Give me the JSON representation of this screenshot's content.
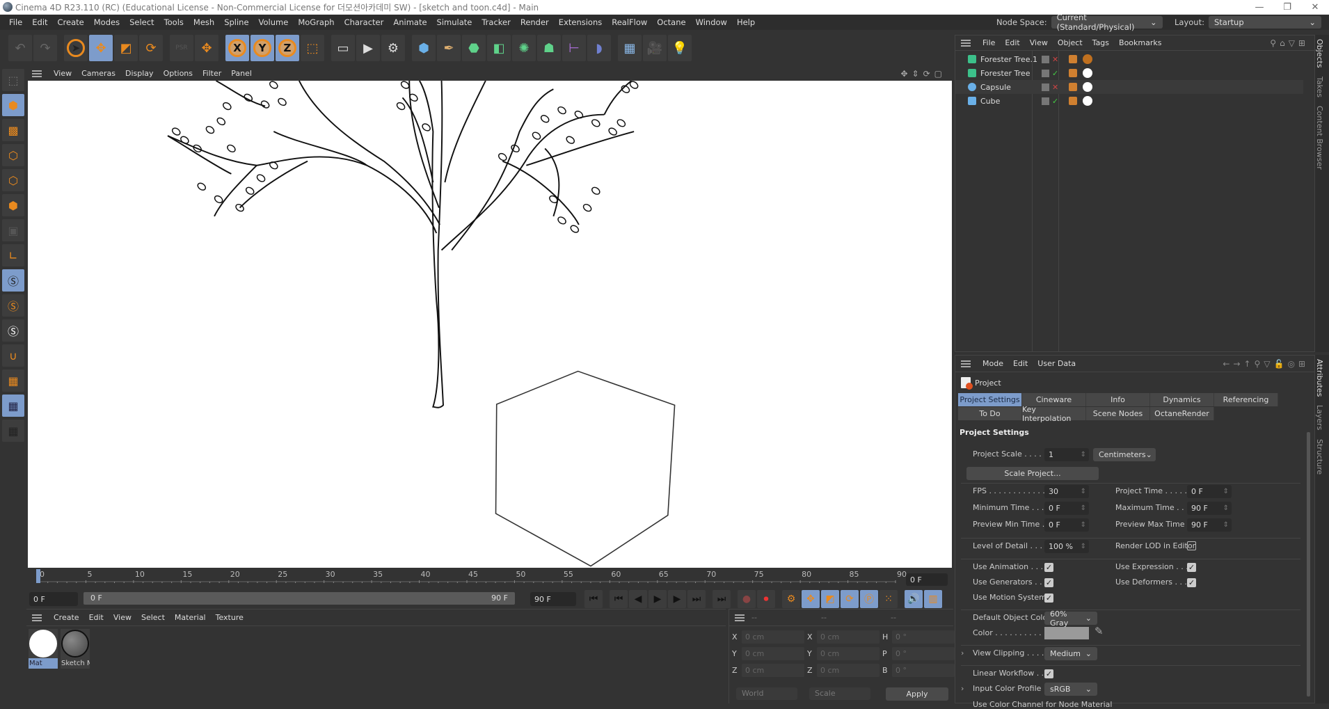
{
  "window": {
    "title": "Cinema 4D R23.110 (RC) (Educational License - Non-Commercial License for 더모션아카데미 SW) - [sketch and toon.c4d] - Main",
    "minimize": "—",
    "maximize": "❐",
    "close": "✕"
  },
  "menubar": {
    "items": [
      "File",
      "Edit",
      "Create",
      "Modes",
      "Select",
      "Tools",
      "Mesh",
      "Spline",
      "Volume",
      "MoGraph",
      "Character",
      "Animate",
      "Simulate",
      "Tracker",
      "Render",
      "Extensions",
      "RealFlow",
      "Octane",
      "Window",
      "Help"
    ],
    "node_space_label": "Node Space:",
    "node_space_value": "Current (Standard/Physical)",
    "layout_label": "Layout:",
    "layout_value": "Startup"
  },
  "toolbar": {
    "x_label": "X",
    "y_label": "Y",
    "z_label": "Z",
    "psr_label": "PSR"
  },
  "viewport": {
    "menu": [
      "View",
      "Cameras",
      "Display",
      "Options",
      "Filter",
      "Panel"
    ]
  },
  "timeline": {
    "ticks": [
      "0",
      "5",
      "10",
      "15",
      "20",
      "25",
      "30",
      "35",
      "40",
      "45",
      "50",
      "55",
      "60",
      "65",
      "70",
      "75",
      "80",
      "85",
      "90"
    ],
    "current_frame": "0 F",
    "start": "0 F",
    "range_start": "0 F",
    "range_end": "90 F",
    "end": "90 F",
    "max_frames": 90
  },
  "materials": {
    "menu": [
      "Create",
      "Edit",
      "View",
      "Select",
      "Material",
      "Texture"
    ],
    "items": [
      {
        "name": "Mat",
        "selected": true
      },
      {
        "name": "Sketch M",
        "selected": false
      }
    ]
  },
  "coords": {
    "headers": [
      "--",
      "--",
      "--"
    ],
    "rows": [
      {
        "a": "X",
        "av": "0 cm",
        "b": "X",
        "bv": "0 cm",
        "c": "H",
        "cv": "0 °"
      },
      {
        "a": "Y",
        "av": "0 cm",
        "b": "Y",
        "bv": "0 cm",
        "c": "P",
        "cv": "0 °"
      },
      {
        "a": "Z",
        "av": "0 cm",
        "b": "Z",
        "bv": "0 cm",
        "c": "B",
        "cv": "0 °"
      }
    ],
    "mode": "World",
    "scale": "Scale",
    "apply": "Apply"
  },
  "objects": {
    "menu": [
      "File",
      "Edit",
      "View",
      "Object",
      "Tags",
      "Bookmarks"
    ],
    "items": [
      {
        "name": "Forester Tree.1",
        "icon": "tree-icon",
        "enabled": false
      },
      {
        "name": "Forester Tree",
        "icon": "tree-icon",
        "enabled": true
      },
      {
        "name": "Capsule",
        "icon": "capsule-icon",
        "enabled": false
      },
      {
        "name": "Cube",
        "icon": "cube-icon",
        "enabled": true
      }
    ]
  },
  "side_tabs": {
    "top": [
      "Objects",
      "Takes",
      "Content Browser"
    ],
    "bottom": [
      "Attributes",
      "Layers",
      "Structure"
    ]
  },
  "attributes": {
    "menu": [
      "Mode",
      "Edit",
      "User Data"
    ],
    "object": "Project",
    "tabs_row1": [
      "Project Settings",
      "Cineware",
      "Info",
      "Dynamics",
      "Referencing"
    ],
    "tabs_row2": [
      "To Do",
      "Key Interpolation",
      "Scene Nodes",
      "OctaneRender"
    ],
    "section": "Project Settings",
    "project_scale_label": "Project Scale . . . . .",
    "project_scale": "1",
    "project_scale_unit": "Centimeters",
    "scale_project": "Scale Project...",
    "fps_label": "FPS . . . . . . . . . . . .",
    "fps": "30",
    "project_time_label": "Project Time . . . . .",
    "project_time": "0 F",
    "min_time_label": "Minimum Time . . .",
    "min_time": "0 F",
    "max_time_label": "Maximum Time . . .",
    "max_time": "90 F",
    "prev_min_label": "Preview Min Time . .",
    "prev_min": "0 F",
    "prev_max_label": "Preview Max Time .",
    "prev_max": "90 F",
    "lod_label": "Level of Detail . . . .",
    "lod": "100 %",
    "render_lod_label": "Render LOD in Editor",
    "render_lod": false,
    "use_animation_label": "Use Animation . . . .",
    "use_animation": true,
    "use_expression_label": "Use Expression . . . .",
    "use_expression": true,
    "use_generators_label": "Use Generators . . .",
    "use_generators": true,
    "use_deformers_label": "Use Deformers . . . .",
    "use_deformers": true,
    "use_motion_label": "Use Motion System",
    "use_motion": true,
    "default_color_label": "Default Object Color",
    "default_color": "60% Gray",
    "color_label": "Color . . . . . . . . . .",
    "color_value": "#9a9a9a",
    "view_clipping_label": "View Clipping . . . .",
    "view_clipping": "Medium",
    "linear_workflow_label": "Linear Workflow . . .",
    "linear_workflow": true,
    "input_profile_label": "Input Color Profile .",
    "input_profile": "sRGB",
    "node_material_label": "Use Color Channel for Node Material"
  },
  "colors": {
    "accent": "#7d9ccb",
    "orange": "#e98a1f",
    "panel": "#333333"
  }
}
